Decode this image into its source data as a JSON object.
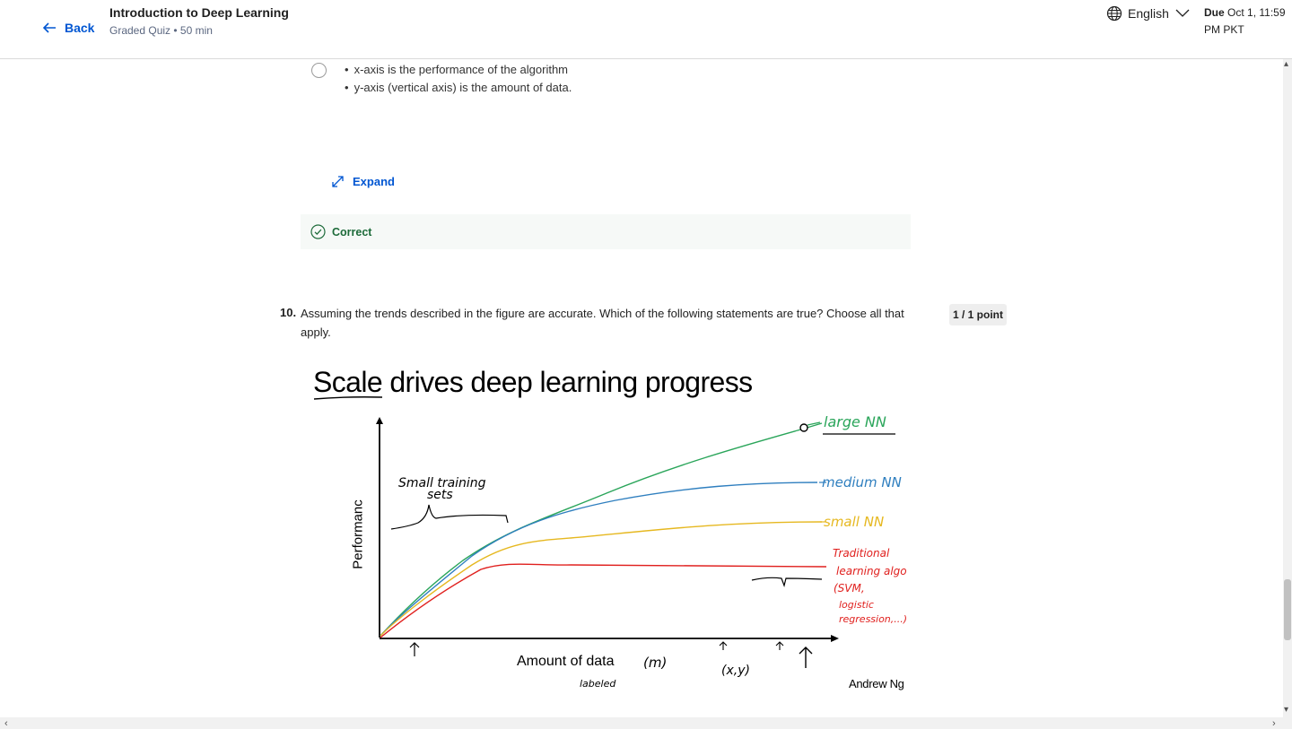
{
  "header": {
    "back_label": "Back",
    "course_title": "Introduction to Deep Learning",
    "course_sub": "Graded Quiz • 50 min",
    "language": "English",
    "due_label": "Due",
    "due_date_line1": "Oct 1, 11:59",
    "due_date_line2": "PM PKT"
  },
  "prev_question": {
    "option_lines": [
      "x-axis is the performance of the algorithm",
      "y-axis (vertical axis) is the amount of data."
    ],
    "expand_label": "Expand",
    "result_label": "Correct"
  },
  "question": {
    "number": "10.",
    "text": "Assuming the trends described in the figure are accurate. Which of the following statements are true? Choose all that apply.",
    "points": "1 / 1 point"
  },
  "figure": {
    "title": "Scale drives deep learning progress",
    "ylabel": "Performanc",
    "xlabel": "Amount of data",
    "credit": "Andrew Ng",
    "annotations": {
      "small_training": "Small training",
      "sets": "sets",
      "large_nn": "large NN",
      "medium_nn": "medium NN",
      "small_nn": "small NN",
      "trad_1": "Traditional",
      "trad_2": "learning algo",
      "trad_3": "(SVM,",
      "trad_4": "logistic",
      "trad_5": "regression,...)",
      "m": "(m)",
      "labeled": "labeled",
      "xy": "(x,y)"
    },
    "colors": {
      "large": "#2aa55a",
      "medium": "#2f7fbf",
      "small": "#e6b820",
      "traditional": "#e0201e"
    }
  }
}
